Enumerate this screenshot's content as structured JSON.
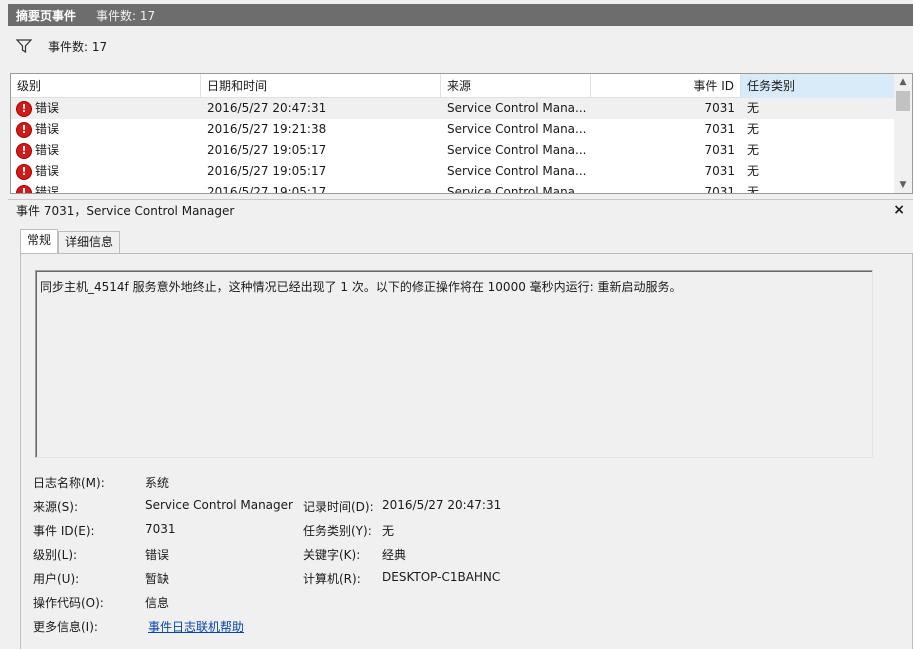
{
  "title": {
    "main": "摘要页事件",
    "count": "事件数: 17"
  },
  "filter": {
    "icon": "filter-icon",
    "label": "事件数: 17"
  },
  "grid": {
    "columns": [
      "级别",
      "日期和时间",
      "来源",
      "事件 ID",
      "任务类别"
    ],
    "rows": [
      {
        "level": "错误",
        "datetime": "2016/5/27 20:47:31",
        "source": "Service Control Mana...",
        "event_id": "7031",
        "task": "无"
      },
      {
        "level": "错误",
        "datetime": "2016/5/27 19:21:38",
        "source": "Service Control Mana...",
        "event_id": "7031",
        "task": "无"
      },
      {
        "level": "错误",
        "datetime": "2016/5/27 19:05:17",
        "source": "Service Control Mana...",
        "event_id": "7031",
        "task": "无"
      },
      {
        "level": "错误",
        "datetime": "2016/5/27 19:05:17",
        "source": "Service Control Mana...",
        "event_id": "7031",
        "task": "无"
      },
      {
        "level": "错误",
        "datetime": "2016/5/27 19:05:17",
        "source": "Service Control Mana...",
        "event_id": "7031",
        "task": "无"
      }
    ]
  },
  "detail": {
    "header": "事件 7031，Service Control Manager",
    "close": "×",
    "tabs": [
      "常规",
      "详细信息"
    ],
    "description": "同步主机_4514f 服务意外地终止，这种情况已经出现了 1 次。以下的修正操作将在 10000 毫秒内运行: 重新启动服务。",
    "props": {
      "log_name_label": "日志名称(M):",
      "log_name": "系统",
      "source_label": "来源(S):",
      "source": "Service Control Manager",
      "logged_label": "记录时间(D):",
      "logged": "2016/5/27 20:47:31",
      "event_id_label": "事件 ID(E):",
      "event_id": "7031",
      "task_label": "任务类别(Y):",
      "task": "无",
      "level_label": "级别(L):",
      "level": "错误",
      "keywords_label": "关键字(K):",
      "keywords": "经典",
      "user_label": "用户(U):",
      "user": "暂缺",
      "computer_label": "计算机(R):",
      "computer": "DESKTOP-C1BAHNC",
      "opcode_label": "操作代码(O):",
      "opcode": "信息",
      "more_info_label": "更多信息(I):",
      "more_info_link": "事件日志联机帮助"
    }
  },
  "colors": {
    "title_bg": "#6d6d6d",
    "error_icon": "#d11a1a",
    "link": "#0645ad",
    "selected_header": "#d9ebf9"
  }
}
